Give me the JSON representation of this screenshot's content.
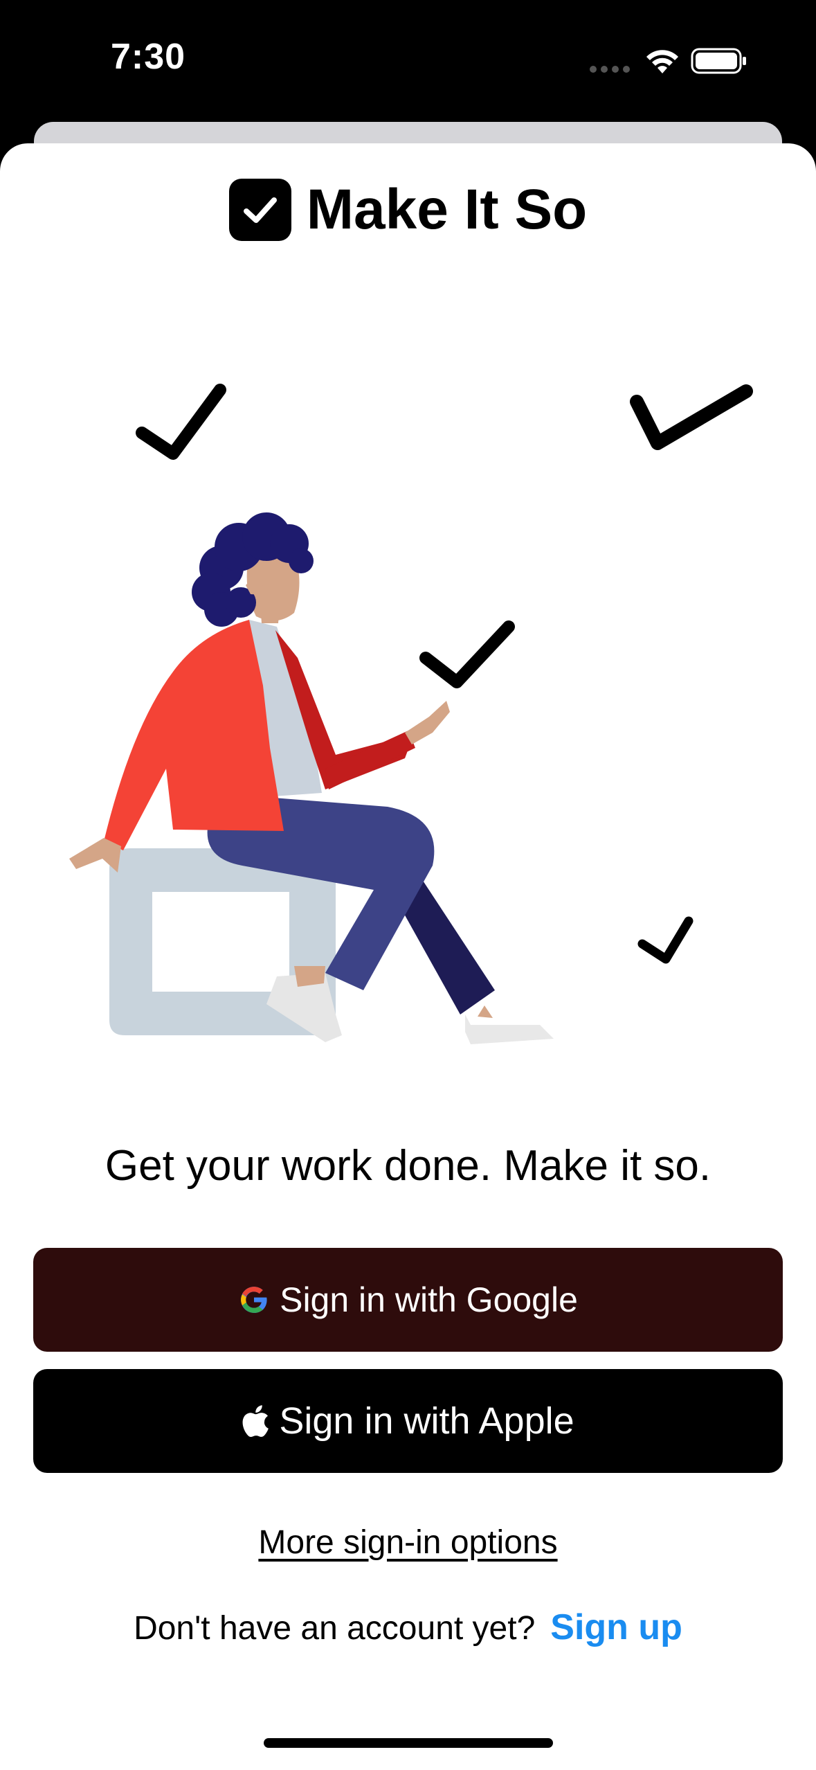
{
  "status_bar": {
    "time": "7:30",
    "icons": [
      "cellular-dots-icon",
      "wifi-icon",
      "battery-icon"
    ]
  },
  "app": {
    "title": "Make It So",
    "logo_icon": "checkbox-icon"
  },
  "illustration": {
    "icon": "person-sitting-checkmarks-illustration",
    "colors": {
      "jacket": "#f44336",
      "pants": "#3d4387",
      "hair": "#1e1b6e",
      "seat": "#c8d3dc"
    }
  },
  "tagline": "Get your work done. Make it so.",
  "buttons": {
    "google": {
      "label": "Sign in with Google",
      "icon": "google-g-icon",
      "color": "#2e0c0c"
    },
    "apple": {
      "label": "Sign in with Apple",
      "icon": "apple-logo-icon",
      "color": "#000000"
    }
  },
  "more_options": "More sign-in options",
  "signup": {
    "prompt": "Don't have an account yet?",
    "link": "Sign up",
    "link_color": "#1a8cf0"
  }
}
